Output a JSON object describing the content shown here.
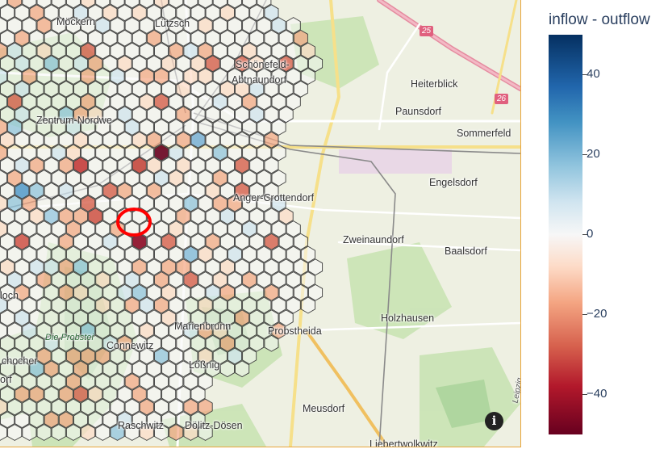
{
  "map": {
    "places": [
      {
        "id": "mockern",
        "label": "Möckern"
      },
      {
        "id": "lutzsch",
        "label": "Lützsch"
      },
      {
        "id": "schonefeld",
        "label": "Schönefeld-"
      },
      {
        "id": "abtnaundorf",
        "label": "Abtnaundorf"
      },
      {
        "id": "heiterblick",
        "label": "Heiterblick"
      },
      {
        "id": "paunsdorf",
        "label": "Paunsdorf"
      },
      {
        "id": "sommerfeld",
        "label": "Sommerfeld"
      },
      {
        "id": "zentrum-nordwest",
        "label": "Zentrum-Nordwe"
      },
      {
        "id": "engelsdorf",
        "label": "Engelsdorf"
      },
      {
        "id": "anger-crottendorf",
        "label": "Anger-Crottendorf"
      },
      {
        "id": "zweinaundorf",
        "label": "Zweinaundorf"
      },
      {
        "id": "baalsdorf",
        "label": "Baalsdorf"
      },
      {
        "id": "holzhausen",
        "label": "Holzhausen"
      },
      {
        "id": "probstheida",
        "label": "Probstheida"
      },
      {
        "id": "marienbrunn",
        "label": "Marienbrunn"
      },
      {
        "id": "connewitz",
        "label": "Connewitz"
      },
      {
        "id": "losnig",
        "label": "Lößnig"
      },
      {
        "id": "meusdorf",
        "label": "Meusdorf"
      },
      {
        "id": "raschwitz",
        "label": "Raschwitz"
      },
      {
        "id": "dolitz",
        "label": "Dölitz-Dösen"
      },
      {
        "id": "liebertwolkwitz",
        "label": "Liebertwolkwitz"
      },
      {
        "id": "schleussig",
        "label": "chocher"
      },
      {
        "id": "lindenau",
        "label": "orf"
      },
      {
        "id": "plagwitz",
        "label": "loch"
      },
      {
        "id": "probstei",
        "label": "Die Probstei"
      },
      {
        "id": "leipzig-road",
        "label": "Leipzig"
      }
    ],
    "road_shields": [
      {
        "id": "a25",
        "label": "25"
      },
      {
        "id": "a26",
        "label": "26"
      }
    ],
    "highlight_marker": {
      "shape": "circle",
      "color": "#ff0000"
    },
    "info_button": {
      "icon": "info-icon",
      "label": "i"
    }
  },
  "colorbar": {
    "title": "inflow - outflow",
    "colorscale": "RdBu",
    "range": [
      -50,
      50
    ],
    "ticks": [
      {
        "value": 40,
        "label": "40"
      },
      {
        "value": 20,
        "label": "20"
      },
      {
        "value": 0,
        "label": "0"
      },
      {
        "value": -20,
        "label": "−20"
      },
      {
        "value": -40,
        "label": "−40"
      }
    ]
  }
}
